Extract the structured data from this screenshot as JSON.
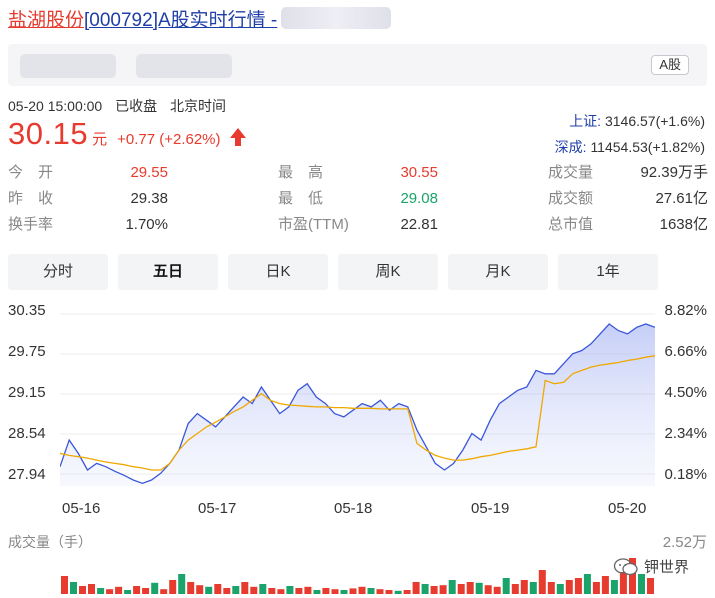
{
  "header": {
    "stock_name": "盐湖股份",
    "title_rest": "[000792]A股实时行情 -",
    "market_badge": "A股"
  },
  "status": {
    "datetime": "05-20 15:00:00",
    "state": "已收盘",
    "timezone": "北京时间"
  },
  "quote": {
    "price": "30.15",
    "unit": "元",
    "change": "+0.77 (+2.62%)"
  },
  "indices": [
    {
      "label": "上证:",
      "value": "3146.57(+1.6%)"
    },
    {
      "label": "深成:",
      "value": "11454.53(+1.82%)"
    }
  ],
  "stats": {
    "open": {
      "label": "今　开",
      "value": "29.55"
    },
    "prev_close": {
      "label": "昨　收",
      "value": "29.38"
    },
    "turnover_rate": {
      "label": "换手率",
      "value": "1.70%"
    },
    "high": {
      "label": "最　高",
      "value": "30.55"
    },
    "low": {
      "label": "最　低",
      "value": "29.08"
    },
    "pe": {
      "label": "市盈(TTM)",
      "value": "22.81"
    },
    "volume": {
      "label": "成交量",
      "value": "92.39万手"
    },
    "amount": {
      "label": "成交额",
      "value": "27.61亿"
    },
    "market_cap": {
      "label": "总市值",
      "value": "1638亿"
    }
  },
  "tabs": [
    "分时",
    "五日",
    "日K",
    "周K",
    "月K",
    "1年"
  ],
  "active_tab": "五日",
  "chart_data": {
    "type": "line",
    "x_ticks": [
      "05-16",
      "05-17",
      "05-18",
      "05-19",
      "05-20"
    ],
    "y_ticks_left": [
      "30.35",
      "29.75",
      "29.15",
      "28.54",
      "27.94"
    ],
    "y_ticks_right": [
      "8.82%",
      "6.66%",
      "4.50%",
      "2.34%",
      "0.18%"
    ],
    "ylim": [
      27.94,
      30.35
    ],
    "series": [
      {
        "role": "price",
        "color": "#3b57d9",
        "values": [
          28.05,
          28.45,
          28.25,
          28.0,
          28.1,
          28.05,
          27.98,
          27.92,
          27.85,
          27.8,
          27.85,
          27.95,
          28.1,
          28.3,
          28.7,
          28.85,
          28.75,
          28.65,
          28.8,
          28.95,
          29.1,
          29.0,
          29.25,
          29.05,
          28.85,
          28.95,
          29.2,
          29.3,
          29.1,
          29.0,
          28.85,
          28.8,
          28.9,
          29.0,
          28.95,
          29.05,
          28.9,
          29.0,
          28.95,
          28.6,
          28.35,
          28.1,
          28.0,
          28.1,
          28.3,
          28.55,
          28.45,
          28.75,
          29.0,
          29.1,
          29.2,
          29.25,
          29.5,
          29.45,
          29.45,
          29.6,
          29.75,
          29.8,
          29.9,
          30.05,
          30.2,
          30.1,
          30.05,
          30.15,
          30.2,
          30.15
        ]
      },
      {
        "role": "average",
        "color": "#f0a800",
        "values": [
          28.25,
          28.22,
          28.2,
          28.18,
          28.15,
          28.12,
          28.1,
          28.08,
          28.05,
          28.03,
          28.0,
          28.0,
          28.1,
          28.3,
          28.45,
          28.55,
          28.65,
          28.72,
          28.8,
          28.88,
          28.95,
          29.05,
          29.15,
          29.05,
          29.0,
          28.98,
          28.97,
          28.96,
          28.95,
          28.95,
          28.94,
          28.94,
          28.93,
          28.93,
          28.93,
          28.92,
          28.92,
          28.92,
          28.92,
          28.4,
          28.3,
          28.22,
          28.18,
          28.15,
          28.15,
          28.17,
          28.2,
          28.22,
          28.25,
          28.28,
          28.3,
          28.32,
          28.35,
          29.35,
          29.3,
          29.32,
          29.45,
          29.5,
          29.55,
          29.58,
          29.6,
          29.62,
          29.65,
          29.67,
          29.7,
          29.72
        ]
      }
    ],
    "volume": {
      "label": "成交量（手）",
      "max_label": "2.52万",
      "bars": [
        0.45,
        0.3,
        0.2,
        0.25,
        0.15,
        0.12,
        0.18,
        0.1,
        0.2,
        0.15,
        0.28,
        0.12,
        0.35,
        0.5,
        0.3,
        0.22,
        0.18,
        0.25,
        0.15,
        0.2,
        0.3,
        0.18,
        0.25,
        0.15,
        0.12,
        0.2,
        0.15,
        0.18,
        0.1,
        0.15,
        0.12,
        0.1,
        0.14,
        0.18,
        0.15,
        0.12,
        0.1,
        0.08,
        0.1,
        0.3,
        0.25,
        0.2,
        0.22,
        0.35,
        0.25,
        0.3,
        0.28,
        0.22,
        0.18,
        0.4,
        0.25,
        0.35,
        0.3,
        0.6,
        0.3,
        0.25,
        0.35,
        0.4,
        0.5,
        0.3,
        0.45,
        0.35,
        0.55,
        0.9,
        0.5,
        0.4
      ]
    }
  },
  "watermark": "钾世界"
}
